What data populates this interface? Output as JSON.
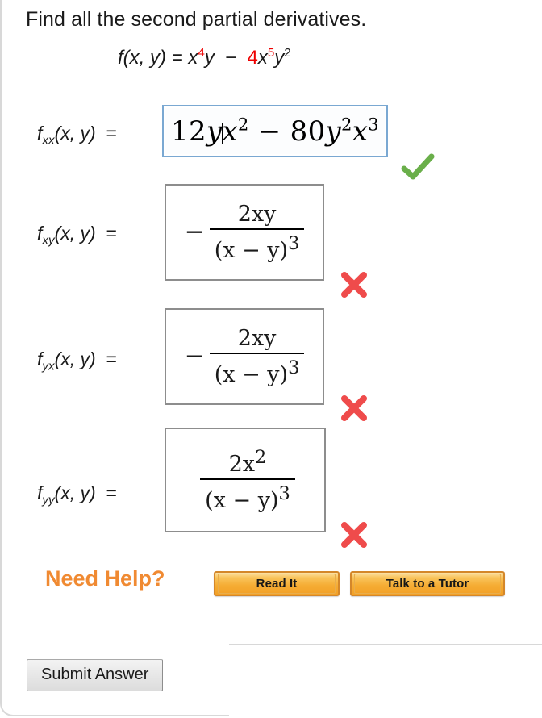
{
  "prompt": "Find all the second partial derivatives.",
  "given": {
    "lhs": "f(x, y)  =  ",
    "term1_base": "x",
    "term1_exp": "4",
    "term1_var": "y",
    "operator": "−",
    "term2_coef": "4",
    "term2_base": "x",
    "term2_exp": "5",
    "term2_var": "y",
    "term2_var_exp": "2"
  },
  "rows": [
    {
      "label_f": "f",
      "label_sub": "xx",
      "label_args": "(x, y)",
      "label_eq": "=",
      "answer_text": "12yx² − 80y²x³",
      "answer_kind": "inline",
      "inline": {
        "coef": "12",
        "v1": "y",
        "v2": "x",
        "v2_exp": "2",
        "op": "−",
        "coef2": "80",
        "v3": "y",
        "v3_exp": "2",
        "v4": "x",
        "v4_exp": "3"
      },
      "has_caret": true,
      "focused": true,
      "result": "correct",
      "result_icon": "green-check-icon"
    },
    {
      "label_f": "f",
      "label_sub": "xy",
      "label_args": "(x, y)",
      "label_eq": "=",
      "answer_text": "− 2xy / (x − y)³",
      "answer_kind": "fraction",
      "fraction": {
        "sign": "−",
        "numerator_coef": "2",
        "numerator_vars": "xy",
        "denominator": "(x − y)",
        "denominator_exp": "3"
      },
      "has_caret": false,
      "focused": false,
      "result": "incorrect",
      "result_icon": "red-x-icon"
    },
    {
      "label_f": "f",
      "label_sub": "yx",
      "label_args": "(x, y)",
      "label_eq": "=",
      "answer_text": "− 2xy / (x − y)³",
      "answer_kind": "fraction",
      "fraction": {
        "sign": "−",
        "numerator_coef": "2",
        "numerator_vars": "xy",
        "denominator": "(x − y)",
        "denominator_exp": "3"
      },
      "has_caret": false,
      "focused": false,
      "result": "incorrect",
      "result_icon": "red-x-icon"
    },
    {
      "label_f": "f",
      "label_sub": "yy",
      "label_args": "(x, y)",
      "label_eq": "=",
      "answer_text": "2x² / (x − y)³",
      "answer_kind": "fraction",
      "fraction": {
        "sign": "",
        "numerator_coef": "2",
        "numerator_vars": "x",
        "numerator_vars_exp": "2",
        "denominator": "(x − y)",
        "denominator_exp": "3"
      },
      "has_caret": false,
      "focused": false,
      "result": "incorrect",
      "result_icon": "red-x-icon"
    }
  ],
  "need_help": {
    "label": "Need Help?",
    "read_it": "Read It",
    "talk_to_tutor": "Talk to a Tutor"
  },
  "submit": {
    "label": "Submit Answer"
  },
  "colors": {
    "highlight_red": "#ee0000",
    "need_help_orange": "#f08a32",
    "button_orange": "#f5ab32",
    "correct_green": "#6aaf4a",
    "incorrect_red": "#ef4b4b",
    "focus_blue": "#7aa8d2",
    "panel_border": "#d8d8d8"
  }
}
